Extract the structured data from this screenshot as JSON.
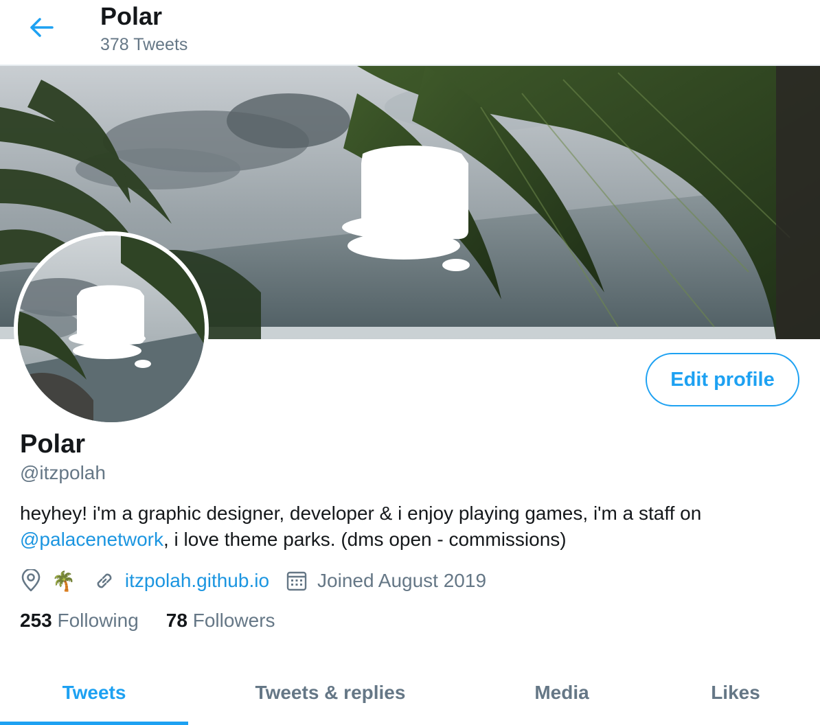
{
  "header": {
    "title": "Polar",
    "tweet_count": "378 Tweets"
  },
  "profile": {
    "name": "Polar",
    "handle": "@itzpolah",
    "bio_part1": "heyhey! i'm a graphic designer, developer & i enjoy playing games, i'm a staff on",
    "bio_mention": "@palacenetwork",
    "bio_part2": ", i love theme parks. (dms open - commissions)",
    "location_emoji": "🌴",
    "website": "itzpolah.github.io",
    "joined": "Joined August 2019",
    "edit_label": "Edit profile"
  },
  "stats": {
    "following_count": "253",
    "following_label": "Following",
    "followers_count": "78",
    "followers_label": "Followers"
  },
  "tabs": {
    "tweets": "Tweets",
    "replies": "Tweets & replies",
    "media": "Media",
    "likes": "Likes"
  },
  "icons": {
    "back": "arrow-left-icon",
    "location": "location-pin-icon",
    "link": "link-icon",
    "calendar": "calendar-icon"
  },
  "colors": {
    "accent": "#1da1f2",
    "link": "#1b95e0",
    "secondary_text": "#657786",
    "primary_text": "#14171a"
  }
}
